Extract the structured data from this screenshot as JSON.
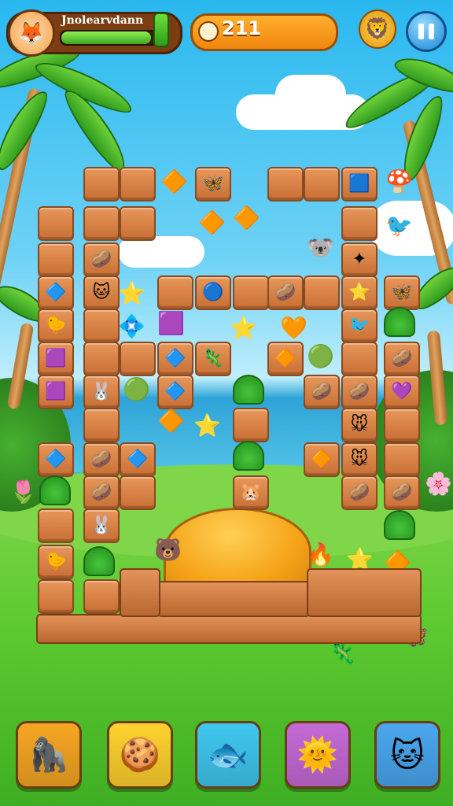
{
  "hud": {
    "player_name": "Jnolearvdann",
    "health_fraction": 0.88,
    "score": "211",
    "pause_icon": "pause-icon",
    "avatar_icon": "fox-avatar-icon",
    "coin_icon": "coin-icon",
    "lion_icon": "lion-icon"
  },
  "board": {
    "colors": {
      "tile": "#d9813f",
      "tile_border": "#8a4a20"
    }
  },
  "bottom_bar": {
    "buttons": [
      {
        "icon": "yeti-icon",
        "color": "#f6a623"
      },
      {
        "icon": "cookie-icon",
        "color": "#ffd22e"
      },
      {
        "icon": "fish-icon",
        "color": "#3fc8f0"
      },
      {
        "icon": "sun-icon",
        "color": "#c56ad6"
      },
      {
        "icon": "cat-icon",
        "color": "#4aa7f0"
      }
    ]
  }
}
